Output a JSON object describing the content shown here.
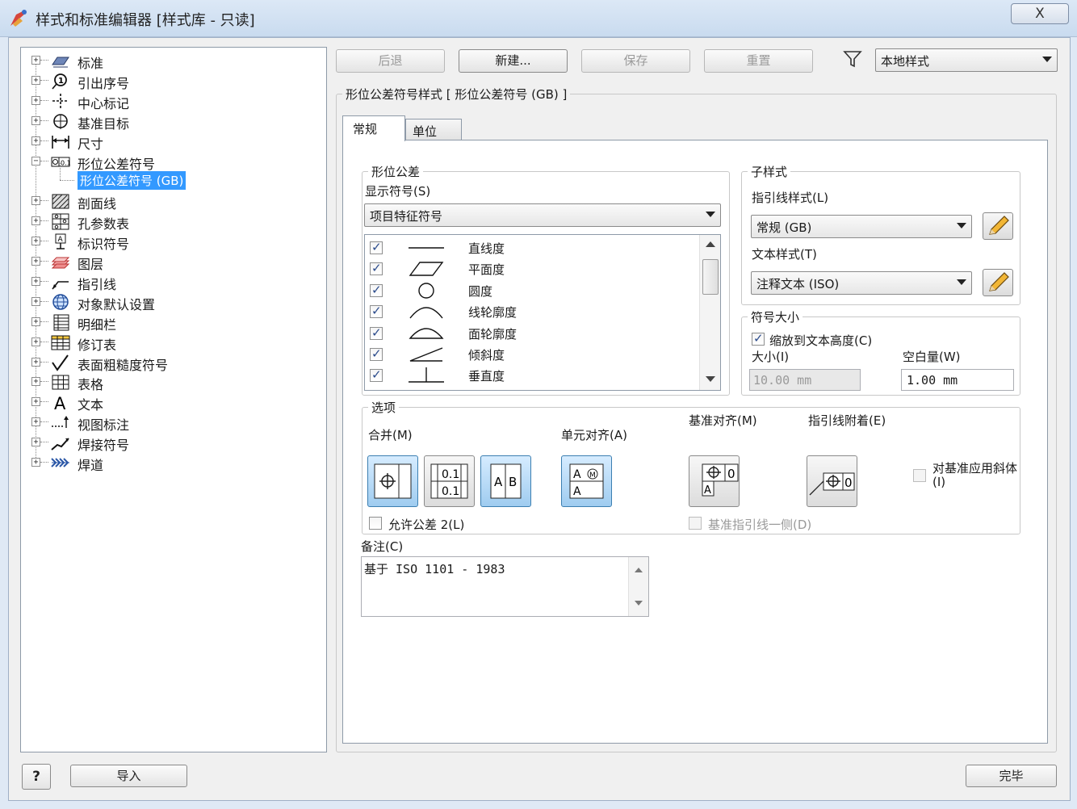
{
  "window": {
    "title": "样式和标准编辑器 [样式库 - 只读]",
    "close_glyph": "X"
  },
  "tree": {
    "items": [
      {
        "label": "标准",
        "icon": "standard-icon",
        "expander": "+"
      },
      {
        "label": "引出序号",
        "icon": "balloon-icon",
        "expander": "+"
      },
      {
        "label": "中心标记",
        "icon": "center-mark-icon",
        "expander": "+"
      },
      {
        "label": "基准目标",
        "icon": "datum-target-icon",
        "expander": "+"
      },
      {
        "label": "尺寸",
        "icon": "dimension-icon",
        "expander": "+"
      },
      {
        "label": "形位公差符号",
        "icon": "fcf-icon",
        "expander": "−"
      },
      {
        "label": "形位公差符号 (GB)",
        "icon": "",
        "expander": "",
        "selected": true
      },
      {
        "label": "剖面线",
        "icon": "hatch-icon",
        "expander": "+"
      },
      {
        "label": "孔参数表",
        "icon": "hole-table-icon",
        "expander": "+"
      },
      {
        "label": "标识符号",
        "icon": "id-symbol-icon",
        "expander": "+"
      },
      {
        "label": "图层",
        "icon": "layers-icon",
        "expander": "+"
      },
      {
        "label": "指引线",
        "icon": "leader-icon",
        "expander": "+"
      },
      {
        "label": "对象默认设置",
        "icon": "object-defaults-icon",
        "expander": "+"
      },
      {
        "label": "明细栏",
        "icon": "parts-list-icon",
        "expander": "+"
      },
      {
        "label": "修订表",
        "icon": "revision-table-icon",
        "expander": "+"
      },
      {
        "label": "表面粗糙度符号",
        "icon": "surface-texture-icon",
        "expander": "+"
      },
      {
        "label": "表格",
        "icon": "table-icon",
        "expander": "+"
      },
      {
        "label": "文本",
        "icon": "text-icon",
        "expander": "+"
      },
      {
        "label": "视图标注",
        "icon": "view-annotation-icon",
        "expander": "+"
      },
      {
        "label": "焊接符号",
        "icon": "weld-symbol-icon",
        "expander": "+"
      },
      {
        "label": "焊道",
        "icon": "weld-bead-icon",
        "expander": "+"
      }
    ]
  },
  "toolbar": {
    "back": "后退",
    "new": "新建...",
    "save": "保存",
    "reset": "重置",
    "filter_value": "本地样式"
  },
  "style_header": "形位公差符号样式 [ 形位公差符号 (GB) ]",
  "tabs": [
    "常规",
    "单位"
  ],
  "gdt": {
    "group_title": "形位公差",
    "display_label": "显示符号(S)",
    "display_value": "项目特征符号",
    "symbols": [
      {
        "name": "直线度",
        "checked": true
      },
      {
        "name": "平面度",
        "checked": true
      },
      {
        "name": "圆度",
        "checked": true
      },
      {
        "name": "线轮廓度",
        "checked": true
      },
      {
        "name": "面轮廓度",
        "checked": true
      },
      {
        "name": "倾斜度",
        "checked": true
      },
      {
        "name": "垂直度",
        "checked": true
      }
    ]
  },
  "sub_styles": {
    "group_title": "子样式",
    "leader_label": "指引线样式(L)",
    "leader_value": "常规 (GB)",
    "text_label": "文本样式(T)",
    "text_value": "注释文本 (ISO)"
  },
  "symbol_size": {
    "group_title": "符号大小",
    "scale_label": "缩放到文本高度(C)",
    "scale_checked": true,
    "size_label": "大小(I)",
    "size_value": "10.00 mm",
    "gap_label": "空白量(W)",
    "gap_value": "1.00 mm"
  },
  "options": {
    "group_title": "选项",
    "merge_label": "合并(M)",
    "cell_align_label": "单元对齐(A)",
    "datum_align_label": "基准对齐(M)",
    "leader_attach_label": "指引线附着(E)",
    "italic_label": "对基准应用斜体(I)",
    "allow_tol2_label": "允许公差 2(L)",
    "datum_leader_side_label": "基准指引线一侧(D)"
  },
  "notes": {
    "label": "备注(C)",
    "value": "基于 ISO 1101 - 1983"
  },
  "footer": {
    "help": "?",
    "import": "导入",
    "done": "完毕"
  },
  "colors": {
    "selection": "#3399ff",
    "title_bar": "#c9dbef",
    "check": "#2b4b8c"
  }
}
